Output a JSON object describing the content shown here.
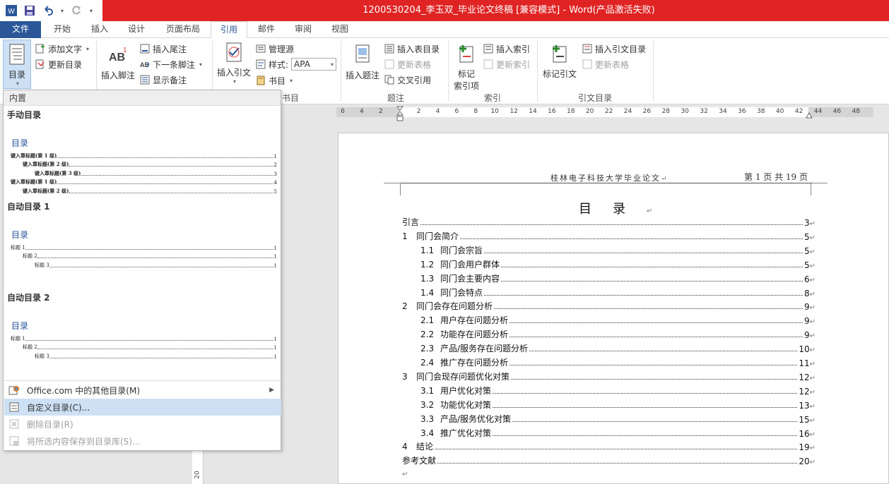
{
  "window": {
    "title": "1200530204_李玉双_毕业论文终稿 [兼容模式] -  Word(产品激活失败)"
  },
  "tabs": [
    "文件",
    "开始",
    "插入",
    "设计",
    "页面布局",
    "引用",
    "邮件",
    "审阅",
    "视图"
  ],
  "ribbon": {
    "toc_group": {
      "toc_button": "目录",
      "add_text": "添加文字",
      "update_toc": "更新目录"
    },
    "footnote_group": {
      "insert_footnote": "插入脚注",
      "insert_endnote": "插入尾注",
      "next_footnote": "下一条脚注",
      "show_notes": "显示备注"
    },
    "citation_group": {
      "insert_citation": "插入引文",
      "manage_sources": "管理源",
      "style_label": "样式:",
      "style_value": "APA",
      "bibliography": "书目",
      "label": "书目"
    },
    "caption_group": {
      "insert_caption": "插入题注",
      "insert_tof": "插入表目录",
      "update_table": "更新表格",
      "cross_ref": "交叉引用",
      "label": "题注"
    },
    "index_group": {
      "mark_entry_1": "标记",
      "mark_entry_2": "索引项",
      "insert_index": "插入索引",
      "update_index": "更新索引",
      "label": "索引"
    },
    "toa_group": {
      "mark_citation": "标记引文",
      "insert_toa": "插入引文目录",
      "update_table": "更新表格",
      "label": "引文目录"
    }
  },
  "ruler": {
    "numbers": [
      "6",
      "4",
      "2",
      "2",
      "4",
      "6",
      "8",
      "10",
      "12",
      "14",
      "16",
      "18",
      "20",
      "22",
      "24",
      "26",
      "28",
      "30",
      "32",
      "34",
      "36",
      "38",
      "40",
      "42",
      "44",
      "46",
      "48"
    ]
  },
  "vruler": {
    "label": "20"
  },
  "gallery": {
    "section": "内置",
    "manual": {
      "title": "手动目录",
      "toc_head": "目录",
      "lines": [
        {
          "text": "键入章标题(第 1 级)",
          "page": "1",
          "level": 1
        },
        {
          "text": "键入章标题(第 2 级)",
          "page": "2",
          "level": 2
        },
        {
          "text": "键入章标题(第 3 级)",
          "page": "3",
          "level": 3
        },
        {
          "text": "键入章标题(第 1 级)",
          "page": "4",
          "level": 1
        },
        {
          "text": "键入章标题(第 2 级)",
          "page": "5",
          "level": 2
        }
      ]
    },
    "auto1": {
      "title": "自动目录 1",
      "toc_head": "目录",
      "lines": [
        {
          "text": "标题 1",
          "page": "1",
          "level": 1
        },
        {
          "text": "标题 2",
          "page": "1",
          "level": 2
        },
        {
          "text": "标题 3",
          "page": "1",
          "level": 3
        }
      ]
    },
    "auto2": {
      "title": "自动目录 2",
      "toc_head": "目录",
      "lines": [
        {
          "text": "标题 1",
          "page": "1",
          "level": 1
        },
        {
          "text": "标题 2",
          "page": "1",
          "level": 2
        },
        {
          "text": "标题 3",
          "page": "1",
          "level": 3
        }
      ]
    },
    "menu": {
      "more": "Office.com 中的其他目录(M)",
      "custom": "自定义目录(C)...",
      "remove": "删除目录(R)",
      "save": "将所选内容保存到目录库(S)..."
    }
  },
  "document": {
    "header_left": "桂林电子科技大学毕业论文",
    "header_right": "第 1 页 共 19 页",
    "toc_title": "目录",
    "return_mark": "↵",
    "toc": [
      {
        "num": "",
        "text": "引言",
        "page": "3",
        "level": 1
      },
      {
        "num": "1",
        "text": "同门会简介",
        "page": "5",
        "level": 1
      },
      {
        "num": "1.1",
        "text": "同门会宗旨",
        "page": "5",
        "level": 2
      },
      {
        "num": "1.2",
        "text": "同门会用户群体",
        "page": "5",
        "level": 2
      },
      {
        "num": "1.3",
        "text": "同门会主要内容",
        "page": "6",
        "level": 2
      },
      {
        "num": "1.4",
        "text": "同门会特点",
        "page": "8",
        "level": 2
      },
      {
        "num": "2",
        "text": "同门会存在问题分析",
        "page": "9",
        "level": 1
      },
      {
        "num": "2.1",
        "text": "用户存在问题分析",
        "page": "9",
        "level": 2
      },
      {
        "num": "2.2",
        "text": "功能存在问题分析",
        "page": "9",
        "level": 2
      },
      {
        "num": "2.3",
        "text": "产品/服务存在问题分析",
        "page": "10",
        "level": 2
      },
      {
        "num": "2.4",
        "text": "推广存在问题分析",
        "page": "11",
        "level": 2
      },
      {
        "num": "3",
        "text": "同门会现存问题优化对策",
        "page": "12",
        "level": 1
      },
      {
        "num": "3.1",
        "text": "用户优化对策",
        "page": "12",
        "level": 2
      },
      {
        "num": "3.2",
        "text": "功能优化对策",
        "page": "13",
        "level": 2
      },
      {
        "num": "3.3",
        "text": "产品/服务优化对策",
        "page": "15",
        "level": 2
      },
      {
        "num": "3.4",
        "text": "推广优化对策",
        "page": "16",
        "level": 2
      },
      {
        "num": "4",
        "text": "结论",
        "page": "19",
        "level": 1
      },
      {
        "num": "",
        "text": "参考文献",
        "page": "20",
        "level": 1
      }
    ]
  },
  "colors": {
    "title_bar": "#e02424",
    "accent": "#2b579a",
    "highlight": "#cde0f4"
  }
}
